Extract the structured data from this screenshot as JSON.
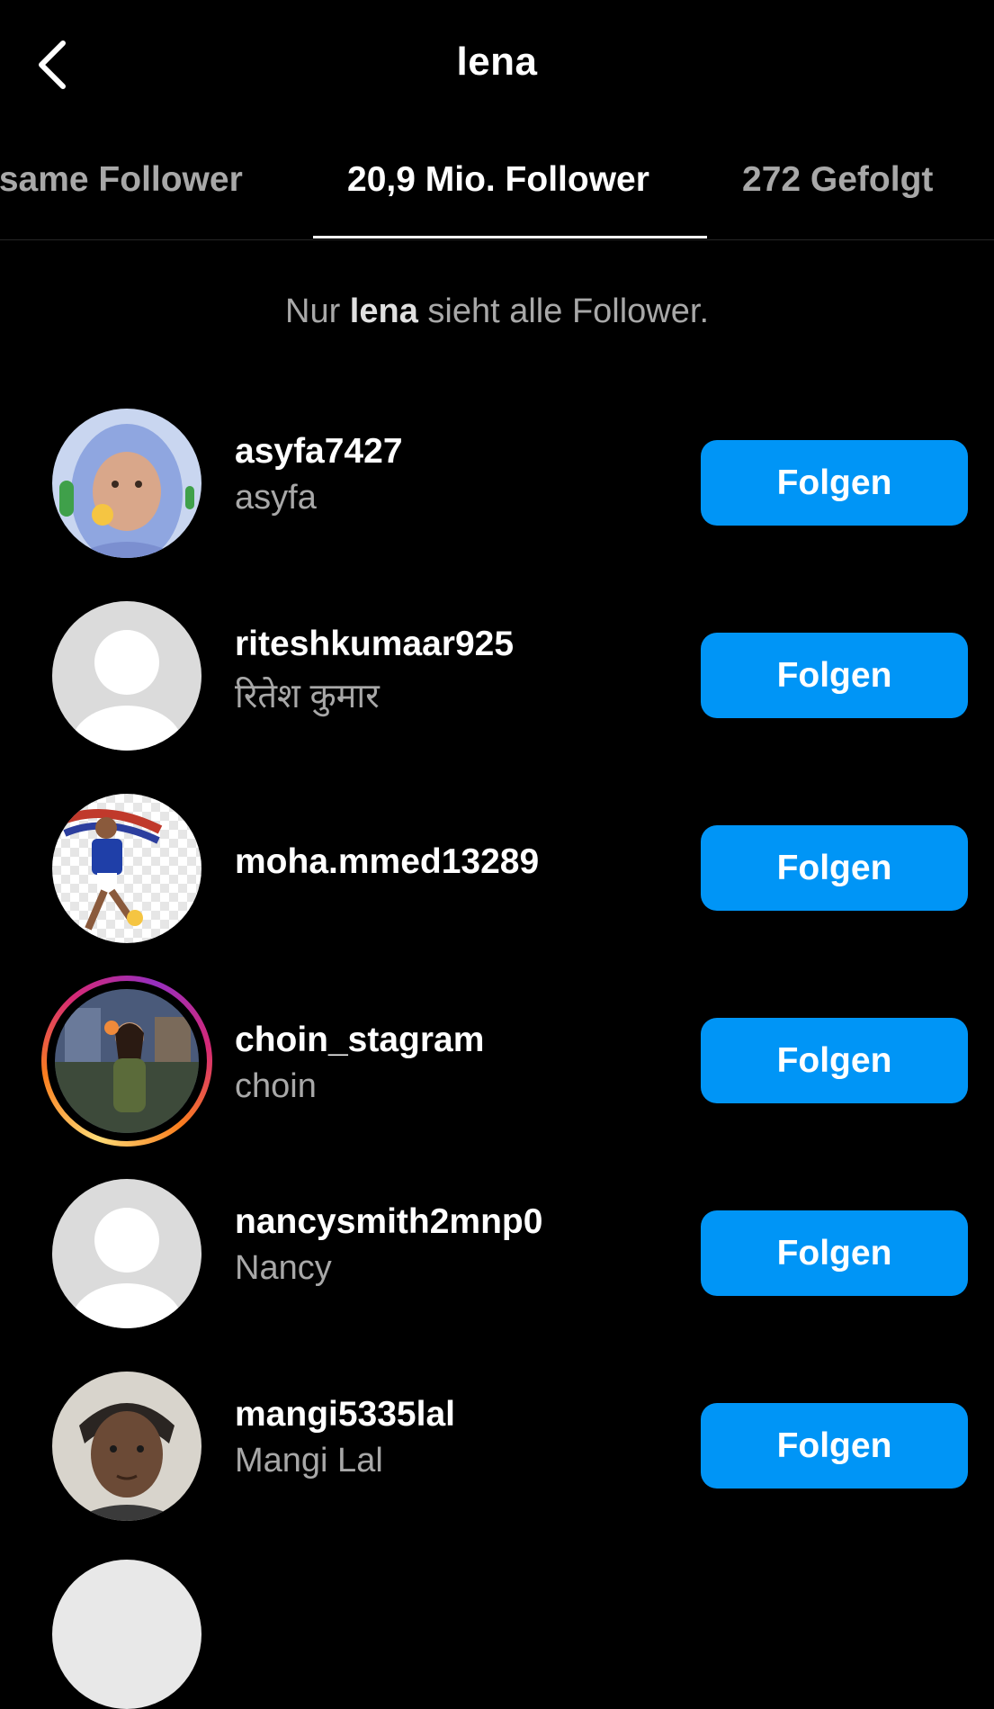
{
  "header": {
    "title": "lena",
    "back_icon": "chevron-left-icon"
  },
  "tabs": [
    {
      "label": "Gemeinsame Follower",
      "visible_label": "ısame Follower",
      "active": false
    },
    {
      "label": "20,9 Mio. Follower",
      "active": true
    },
    {
      "label": "272 Gefolgt",
      "active": false
    }
  ],
  "notice": {
    "prefix": "Nur",
    "name": "lena",
    "suffix": "sieht alle Follower."
  },
  "followers": [
    {
      "username": "asyfa7427",
      "fullname": "asyfa",
      "button": "Folgen",
      "avatar": "photo-girl-hijab",
      "story_ring": false
    },
    {
      "username": "riteshkumaar925",
      "fullname": "रितेश कुमार",
      "button": "Folgen",
      "avatar": "default-avatar",
      "story_ring": false
    },
    {
      "username": "moha.mmed13289",
      "fullname": "",
      "button": "Folgen",
      "avatar": "photo-soccer-player",
      "story_ring": false
    },
    {
      "username": "choin_stagram",
      "fullname": "choin",
      "button": "Folgen",
      "avatar": "photo-woman",
      "story_ring": true
    },
    {
      "username": "nancysmith2mnp0",
      "fullname": "Nancy",
      "button": "Folgen",
      "avatar": "default-avatar",
      "story_ring": false
    },
    {
      "username": "mangi5335lal",
      "fullname": "Mangi Lal",
      "button": "Folgen",
      "avatar": "photo-boy",
      "story_ring": false
    }
  ],
  "colors": {
    "background": "#000000",
    "button": "#0095f6",
    "secondary_text": "#a8a8a8",
    "divider": "#262626"
  }
}
